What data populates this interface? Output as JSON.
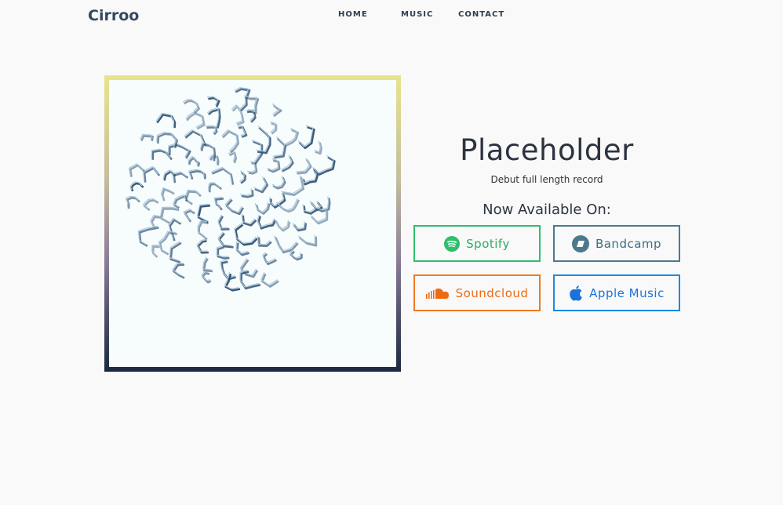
{
  "header": {
    "brand": "Cirroo",
    "nav": [
      {
        "label": "HOME"
      },
      {
        "label": "MUSIC"
      },
      {
        "label": "CONTACT"
      }
    ]
  },
  "album": {
    "title": "Placeholder",
    "subtitle": "Debut full length record",
    "available_heading": "Now Available On:"
  },
  "platforms": [
    {
      "label": "Spotify",
      "icon": "spotify-icon",
      "color": "#27ae60"
    },
    {
      "label": "Bandcamp",
      "icon": "bandcamp-icon",
      "color": "#3b6f82"
    },
    {
      "label": "Soundcloud",
      "icon": "soundcloud-icon",
      "color": "#ee6a12"
    },
    {
      "label": "Apple Music",
      "icon": "apple-icon",
      "color": "#1a73d9"
    }
  ]
}
